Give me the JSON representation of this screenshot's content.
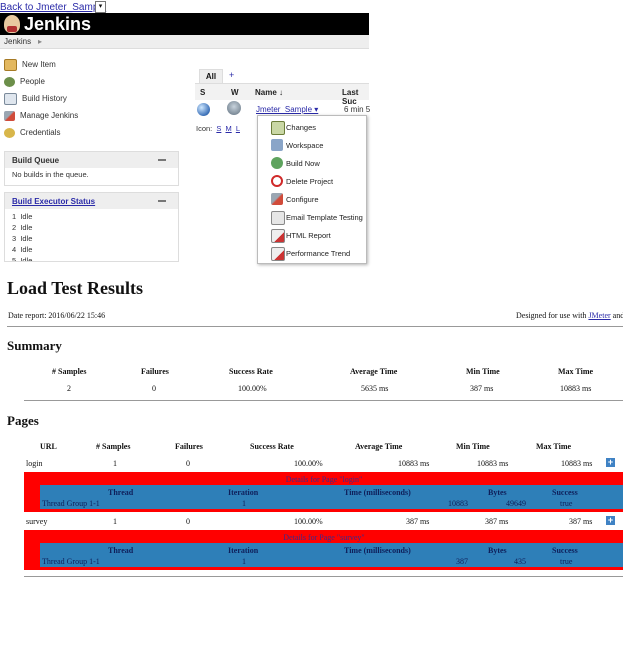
{
  "top_link": {
    "label": "Back to Jmeter_Sample",
    "dropdown": "▾"
  },
  "jenkins": {
    "title": "Jenkins",
    "breadcrumb": "Jenkins",
    "breadcrumb_sep": "▸",
    "tasks": [
      "New Item",
      "People",
      "Build History",
      "Manage Jenkins",
      "Credentials"
    ],
    "build_queue": {
      "title": "Build Queue",
      "body": "No builds in the queue."
    },
    "executor_status": {
      "title": "Build Executor Status",
      "rows": [
        {
          "num": "1",
          "state": "Idle"
        },
        {
          "num": "2",
          "state": "Idle"
        },
        {
          "num": "3",
          "state": "Idle"
        },
        {
          "num": "4",
          "state": "Idle"
        },
        {
          "num": "5",
          "state": "Idle"
        }
      ]
    },
    "tabs": {
      "all": "All",
      "add": "+"
    },
    "columns": {
      "s": "S",
      "w": "W",
      "name": "Name ↓",
      "last": "Last Suc"
    },
    "job": {
      "name": "Jmeter_Sample ▾",
      "last_success": "6 min 5"
    },
    "icon_size": {
      "label": "Icon:",
      "s": "S",
      "m": "M",
      "l": "L"
    },
    "context_menu": [
      "Changes",
      "Workspace",
      "Build Now",
      "Delete Project",
      "Configure",
      "Email Template Testing",
      "HTML Report",
      "Performance Trend"
    ]
  },
  "report": {
    "title": "Load Test Results",
    "date": "Date report: 2016/06/22 15:46",
    "designed_prefix": "Designed for use with ",
    "designed_link": "JMeter",
    "designed_suffix": " and",
    "summary": {
      "heading": "Summary",
      "headers": [
        "# Samples",
        "Failures",
        "Success Rate",
        "Average Time",
        "Min Time",
        "Max Time"
      ],
      "values": [
        "2",
        "0",
        "100.00%",
        "5635 ms",
        "387 ms",
        "10883 ms"
      ]
    },
    "pages": {
      "heading": "Pages",
      "headers": [
        "URL",
        "# Samples",
        "Failures",
        "Success Rate",
        "Average Time",
        "Min Time",
        "Max Time"
      ],
      "rows": [
        {
          "url": "login",
          "samples": "1",
          "failures": "0",
          "success": "100.00%",
          "avg": "10883 ms",
          "min": "10883 ms",
          "max": "10883 ms",
          "details_title": "Details for Page \"login\"",
          "detail_headers": [
            "Thread",
            "Iteration",
            "Time (milliseconds)",
            "Bytes",
            "Success"
          ],
          "detail": {
            "thread": "Thread Group 1-1",
            "iteration": "1",
            "time": "10883",
            "bytes": "49649",
            "success": "true"
          }
        },
        {
          "url": "survey",
          "samples": "1",
          "failures": "0",
          "success": "100.00%",
          "avg": "387 ms",
          "min": "387 ms",
          "max": "387 ms",
          "details_title": "Details for Page \"survey\"",
          "detail_headers": [
            "Thread",
            "Iteration",
            "Time (milliseconds)",
            "Bytes",
            "Success"
          ],
          "detail": {
            "thread": "Thread Group 1-1",
            "iteration": "1",
            "time": "387",
            "bytes": "435",
            "success": "true"
          }
        }
      ]
    }
  },
  "colors": {
    "details_red": "#ff0000",
    "details_blue": "#2e7fb8",
    "link": "#2a2aa8"
  }
}
